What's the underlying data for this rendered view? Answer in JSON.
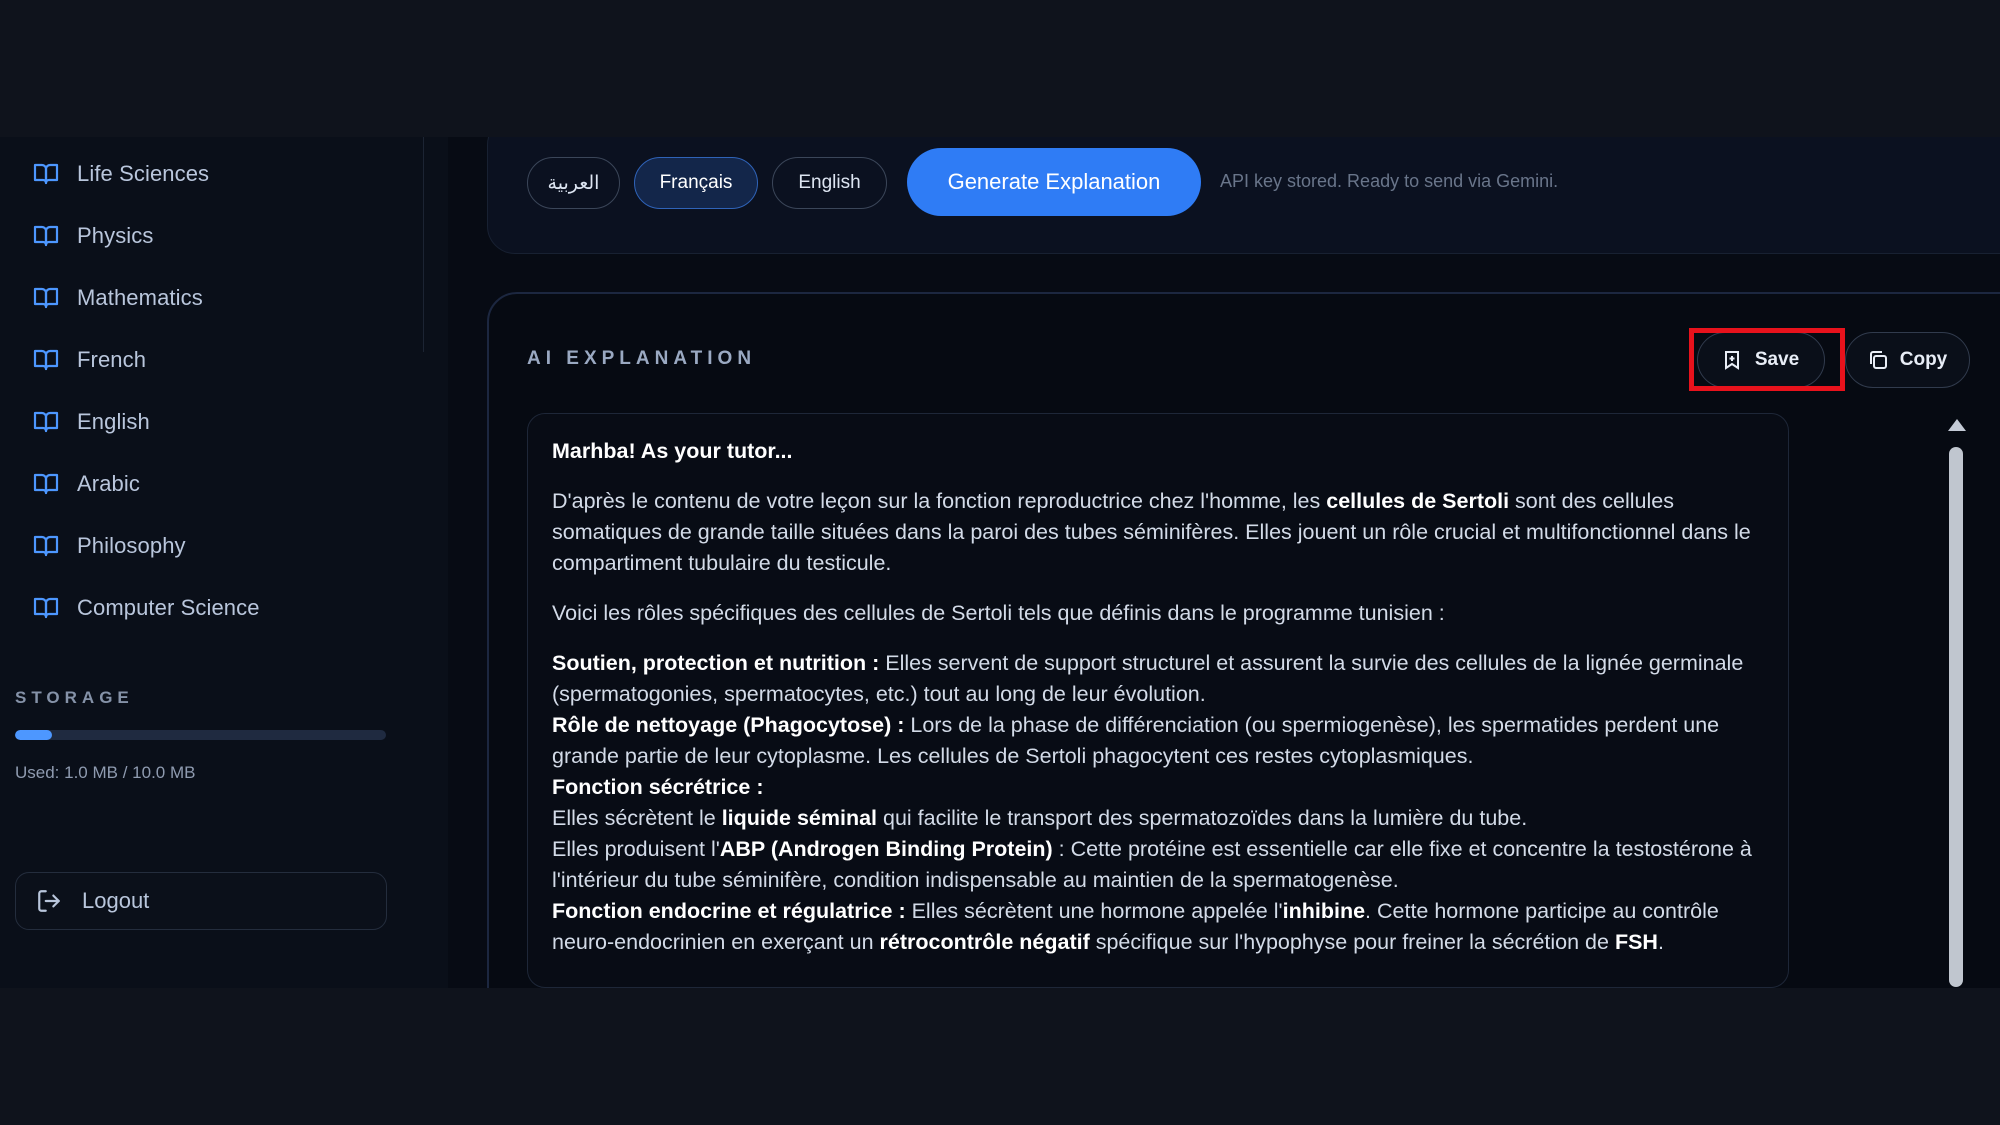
{
  "sidebar": {
    "items": [
      {
        "label": "Life Sciences",
        "icon": "book-icon"
      },
      {
        "label": "Physics",
        "icon": "book-icon"
      },
      {
        "label": "Mathematics",
        "icon": "book-icon"
      },
      {
        "label": "French",
        "icon": "book-icon"
      },
      {
        "label": "English",
        "icon": "book-icon"
      },
      {
        "label": "Arabic",
        "icon": "book-icon"
      },
      {
        "label": "Philosophy",
        "icon": "book-icon"
      },
      {
        "label": "Computer Science",
        "icon": "book-icon"
      }
    ],
    "storage": {
      "title": "STORAGE",
      "used_label": "Used: 1.0 MB / 10.0 MB",
      "used_fraction": 0.1
    },
    "logout_label": "Logout"
  },
  "toolbar": {
    "languages": [
      {
        "label": "العربية",
        "active": false
      },
      {
        "label": "Français",
        "active": true
      },
      {
        "label": "English",
        "active": false
      }
    ],
    "generate_label": "Generate Explanation",
    "status_text": "API key stored. Ready to send via Gemini."
  },
  "explanation": {
    "title": "AI EXPLANATION",
    "save_label": "Save",
    "copy_label": "Copy",
    "greeting": "Marhba! As your tutor...",
    "p1_a": "D'après le contenu de votre leçon sur la fonction reproductrice chez l'homme, les ",
    "p1_b": "cellules de Sertoli",
    "p1_c": " sont des cellules somatiques de grande taille situées dans la paroi des tubes séminifères. Elles jouent un rôle crucial et multifonctionnel dans le compartiment tubulaire du testicule.",
    "p2": "Voici les rôles spécifiques des cellules de Sertoli tels que définis dans le programme tunisien :",
    "r1_title": "Soutien, protection et nutrition :",
    "r1_text": " Elles servent de support structurel et assurent la survie des cellules de la lignée germinale (spermatogonies, spermatocytes, etc.) tout au long de leur évolution.",
    "r2_title": "Rôle de nettoyage (Phagocytose) :",
    "r2_text": " Lors de la phase de différenciation (ou spermiogenèse), les spermatides perdent une grande partie de leur cytoplasme. Les cellules de Sertoli phagocytent ces restes cytoplasmiques.",
    "r3_title": "Fonction sécrétrice :",
    "r3_a": "Elles sécrètent le ",
    "r3_b": "liquide séminal",
    "r3_c": " qui facilite le transport des spermatozoïdes dans la lumière du tube.",
    "r3_d": "Elles produisent l'",
    "r3_e": "ABP (Androgen Binding Protein)",
    "r3_f": " : Cette protéine est essentielle car elle fixe et concentre la testostérone à l'intérieur du tube séminifère, condition indispensable au maintien de la spermatogenèse.",
    "r4_title": "Fonction endocrine et régulatrice :",
    "r4_a": " Elles sécrètent une hormone appelée l'",
    "r4_b": "inhibine",
    "r4_c": ". Cette hormone participe au contrôle neuro-endocrinien en exerçant un ",
    "r4_d": "rétrocontrôle négatif",
    "r4_e": " spécifique sur l'hypophyse pour freiner la sécrétion de ",
    "r4_f": "FSH",
    "r4_g": "."
  },
  "colors": {
    "accent": "#2f7cf5",
    "highlight": "#e8121c",
    "background": "#070b14"
  }
}
